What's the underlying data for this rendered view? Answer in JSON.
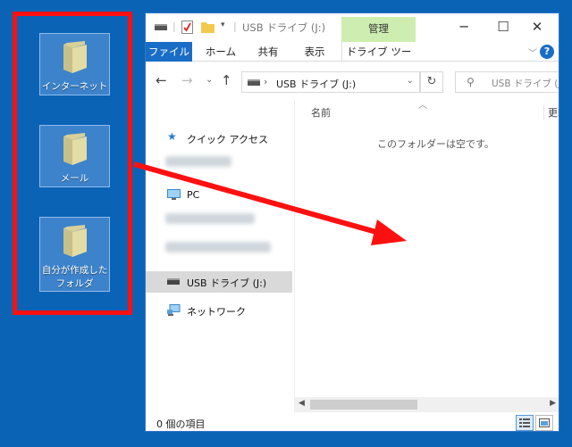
{
  "desktop": {
    "icons": [
      {
        "label": "インターネット"
      },
      {
        "label": "メール"
      },
      {
        "label": "自分が作成した\nフォルダ"
      }
    ],
    "highlight_color": "#ff1010",
    "arrow_color": "#ff1010"
  },
  "window": {
    "title": "USB ドライブ (J:)",
    "manage_tab": "管理",
    "ribbon_tabs": [
      {
        "label": "ファイル"
      },
      {
        "label": "ホーム"
      },
      {
        "label": "共有"
      },
      {
        "label": "表示"
      },
      {
        "label": "ドライブ ツール"
      }
    ],
    "address": "USB ドライブ (J:)",
    "search_placeholder": "USB ドライブ (J:)",
    "nav_items": [
      {
        "label": "クイック アクセス"
      },
      {
        "label": "PC"
      },
      {
        "label": "USB ドライブ (J:)"
      },
      {
        "label": "ネットワーク"
      }
    ],
    "column_name": "名前",
    "column_date": "更新日時",
    "empty_message": "このフォルダーは空です。",
    "status": "0 個の項目"
  }
}
